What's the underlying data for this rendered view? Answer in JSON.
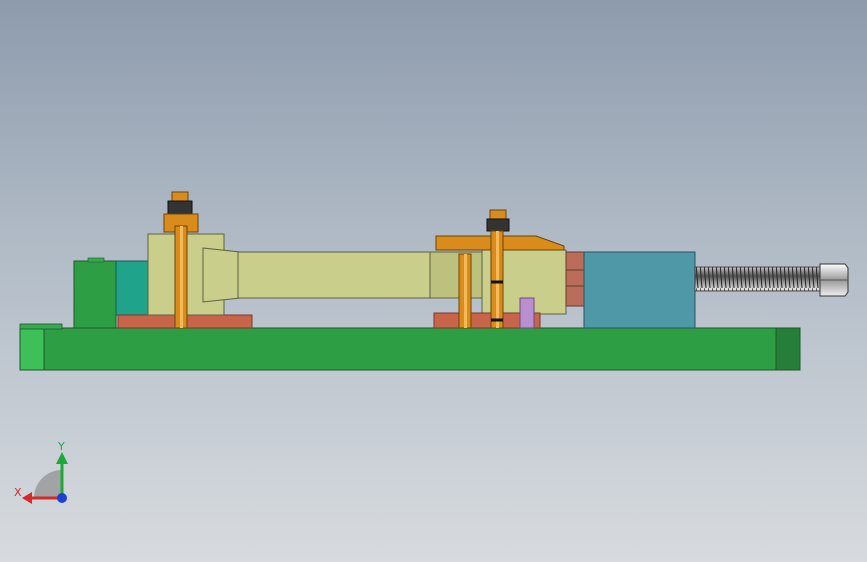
{
  "triad": {
    "x_label": "X",
    "y_label": "Y",
    "x_color": "#d42a2a",
    "y_color": "#1fa83a",
    "z_color": "#1f3fd4"
  },
  "colors": {
    "base_plate": "#2e9e45",
    "spring_housing": "#4e98a8",
    "pin": "#d98c1c",
    "shaft": "#c9cf8a",
    "pad": "#c8644a"
  }
}
